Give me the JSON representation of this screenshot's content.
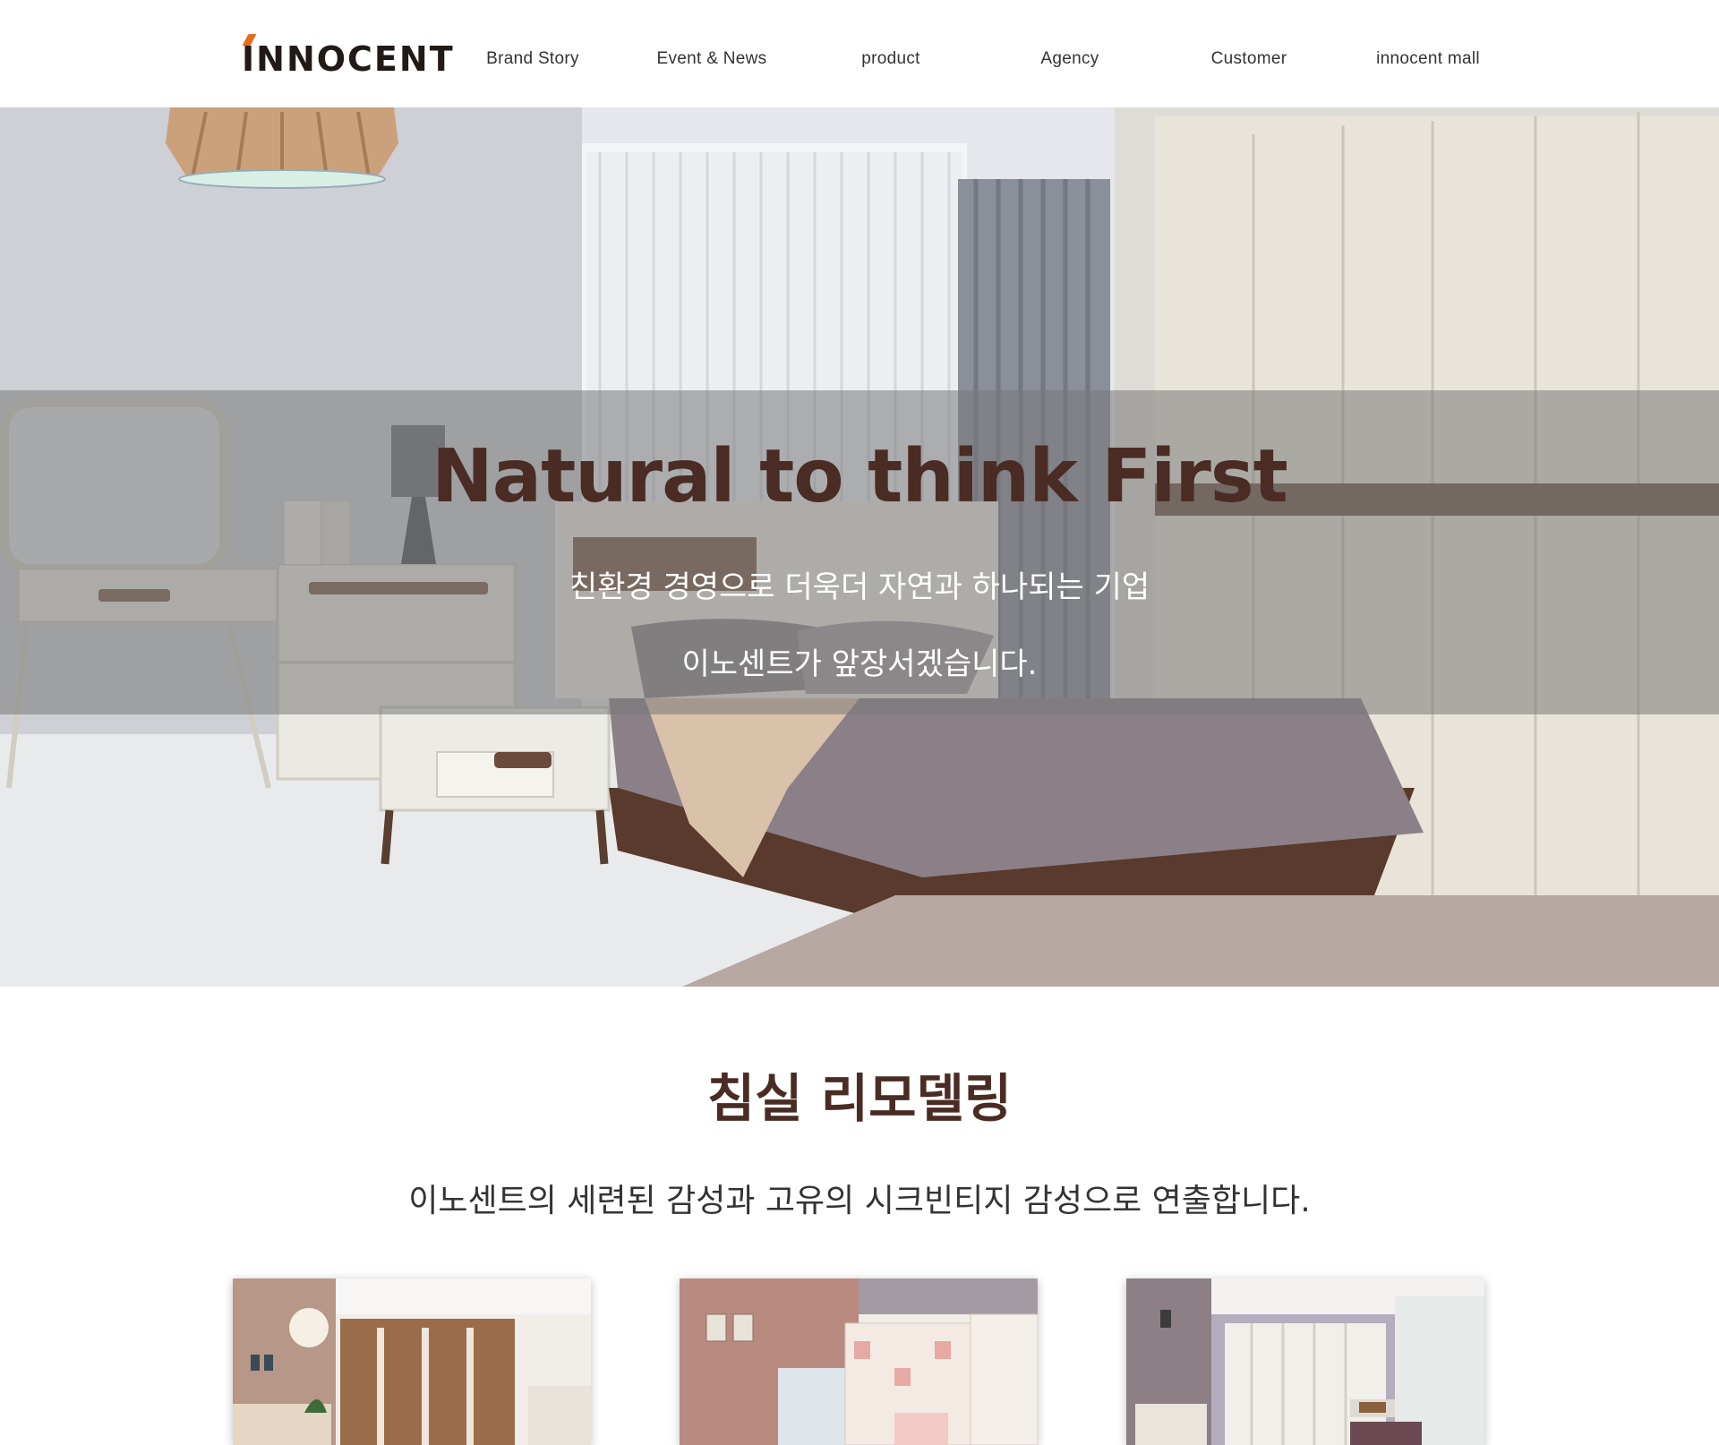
{
  "header": {
    "logo_text": "innocent",
    "nav": [
      {
        "label": "Brand Story"
      },
      {
        "label": "Event & News"
      },
      {
        "label": "product"
      },
      {
        "label": "Agency"
      },
      {
        "label": "Customer"
      },
      {
        "label": "innocent mall"
      }
    ]
  },
  "hero": {
    "title": "Natural to think First",
    "subtitle_line1": "친환경 경영으로 더욱더 자연과 하나되는 기업",
    "subtitle_line2": "이노센트가 앞장서겠습니다."
  },
  "section": {
    "title": "침실 리모델링",
    "description": "이노센트의 세련된 감성과 고유의 시크빈티지 감성으로 연출합니다."
  },
  "cards": [
    {
      "image": "bedroom-wardrobe-photo"
    },
    {
      "image": "kids-room-photo"
    },
    {
      "image": "white-bedroom-photo"
    }
  ],
  "colors": {
    "brand_brown": "#4a2c24",
    "logo_orange": "#e96a1d",
    "hero_band": "rgba(120,120,120,0.55)"
  }
}
